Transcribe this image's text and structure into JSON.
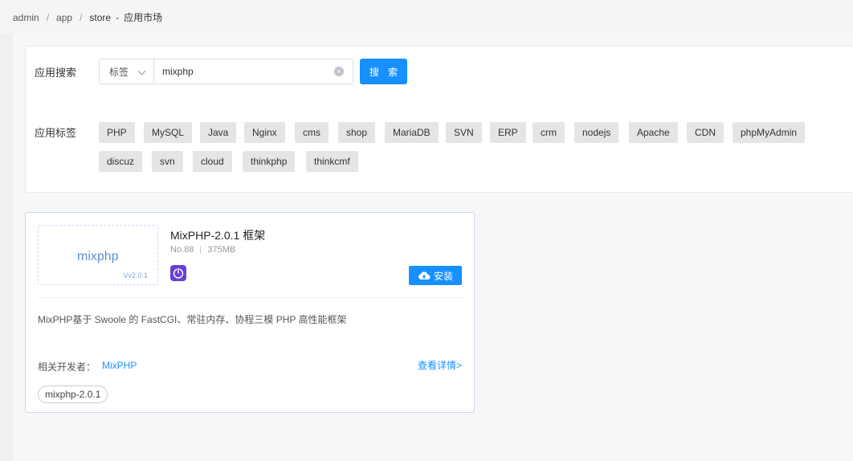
{
  "breadcrumb": {
    "items": [
      "admin",
      "app",
      "store"
    ],
    "separator": "/",
    "dash": "-",
    "page_title": "应用市场"
  },
  "search": {
    "label": "应用搜索",
    "type_select": "标签",
    "input_value": "mixphp",
    "button_label": "搜 索"
  },
  "tags": {
    "label": "应用标签",
    "items": [
      "PHP",
      "MySQL",
      "Java",
      "Nginx",
      "cms",
      "shop",
      "MariaDB",
      "SVN",
      "ERP",
      "crm",
      "nodejs",
      "Apache",
      "CDN",
      "phpMyAdmin",
      "discuz",
      "svn",
      "cloud",
      "thinkphp",
      "thinkcmf"
    ]
  },
  "card": {
    "logo_text": "mixphp",
    "logo_version": "Vv2.0.1",
    "title": "MixPHP-2.0.1 框架",
    "number": "No.88",
    "size": "375MB",
    "install_label": "安装",
    "description": "MixPHP基于 Swoole 的 FastCGI、常驻内存、协程三模 PHP 高性能框架",
    "developer_label": "相关开发者：",
    "developer_name": "MixPHP",
    "detail_link": "查看详情>",
    "version_chip": "mixphp-2.0.1"
  },
  "colors": {
    "accent": "#1890ff",
    "icon_purple": "#6a3fd6"
  }
}
